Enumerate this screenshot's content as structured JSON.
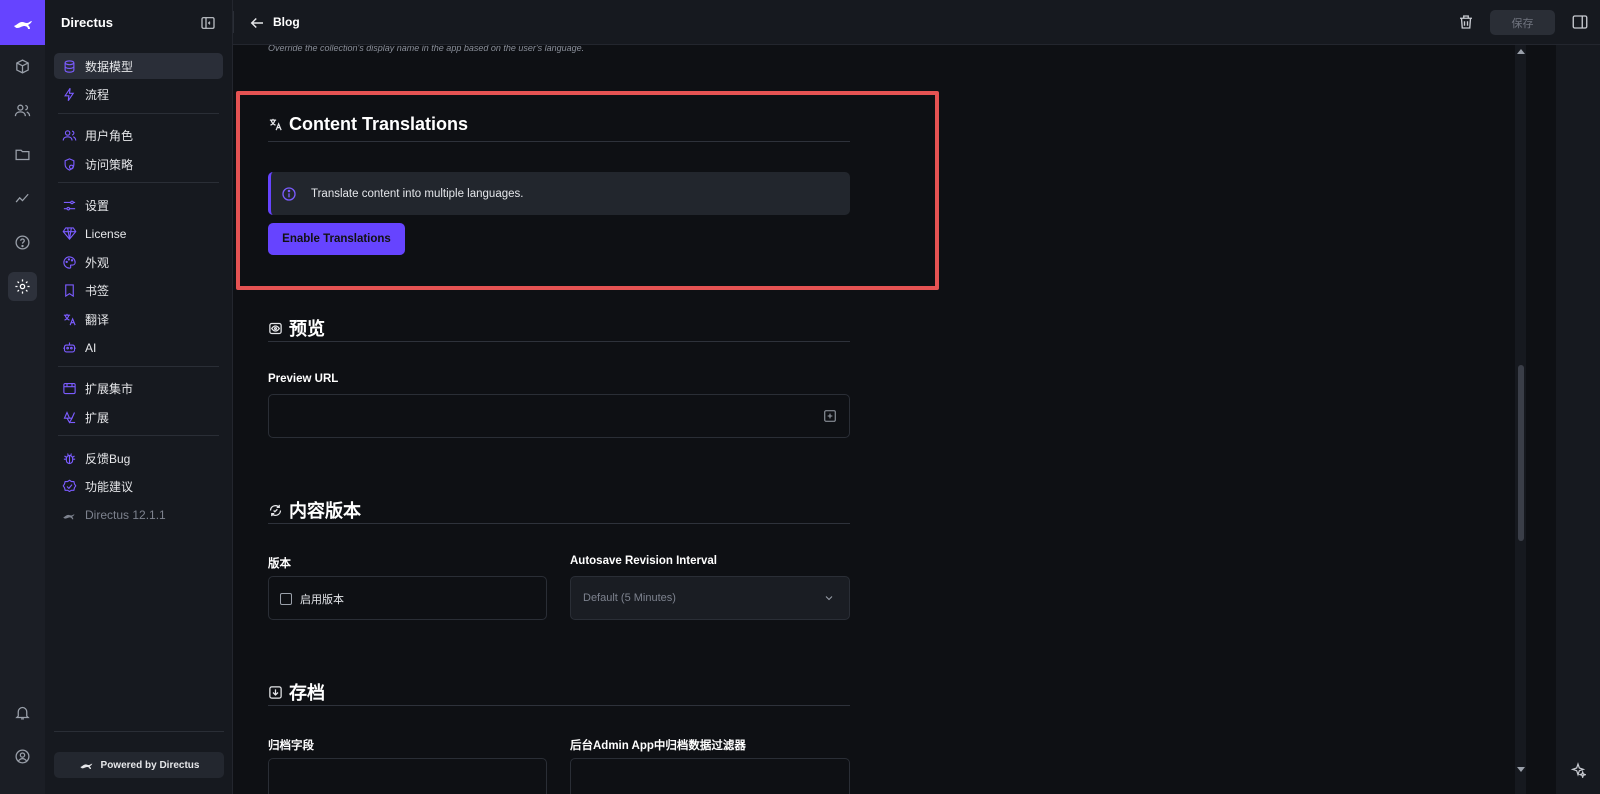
{
  "app": {
    "name": "Directus"
  },
  "topbar": {
    "title": "Blog",
    "save_label": "保存"
  },
  "nav": {
    "groups": [
      [
        {
          "label": "数据模型",
          "icon": "database-icon",
          "active": true
        },
        {
          "label": "流程",
          "icon": "bolt-icon"
        }
      ],
      [
        {
          "label": "用户角色",
          "icon": "users-icon"
        },
        {
          "label": "访问策略",
          "icon": "policy-icon"
        }
      ],
      [
        {
          "label": "设置",
          "icon": "sliders-icon"
        },
        {
          "label": "License",
          "icon": "gem-icon"
        },
        {
          "label": "外观",
          "icon": "palette-icon"
        },
        {
          "label": "书签",
          "icon": "bookmark-icon"
        },
        {
          "label": "翻译",
          "icon": "translate-icon"
        },
        {
          "label": "AI",
          "icon": "robot-icon"
        }
      ],
      [
        {
          "label": "扩展集市",
          "icon": "store-icon"
        },
        {
          "label": "扩展",
          "icon": "extension-icon"
        }
      ],
      [
        {
          "label": "反馈Bug",
          "icon": "bug-icon"
        },
        {
          "label": "功能建议",
          "icon": "verified-icon"
        },
        {
          "label": "Directus 12.1.1",
          "icon": "directus-logo-icon",
          "muted": true
        }
      ]
    ],
    "powered": "Powered by Directus"
  },
  "content": {
    "hint": "Override the collection's display name in the app based on the user's language.",
    "translations": {
      "title": "Content Translations",
      "notice": "Translate content into multiple languages.",
      "button": "Enable Translations"
    },
    "preview": {
      "title": "预览",
      "url_label": "Preview URL"
    },
    "versioning": {
      "title": "内容版本",
      "version_label": "版本",
      "enable_label": "启用版本",
      "autosave_label": "Autosave Revision Interval",
      "autosave_value": "Default (5 Minutes)"
    },
    "archive": {
      "title": "存档",
      "field_label": "归档字段",
      "filter_label": "后台Admin App中归档数据过滤器"
    }
  },
  "colors": {
    "accent": "#6644ff",
    "highlight": "#e55353"
  }
}
